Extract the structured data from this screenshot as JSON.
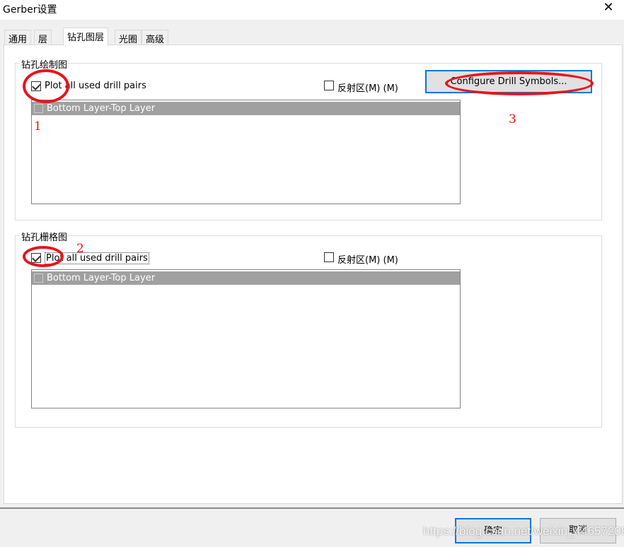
{
  "window": {
    "title": "Gerber设置",
    "close_icon": "close-icon"
  },
  "tabs": [
    {
      "label": "通用"
    },
    {
      "label": "层"
    },
    {
      "label": "钻孔图层",
      "active": true
    },
    {
      "label": "光圈"
    },
    {
      "label": "高级"
    }
  ],
  "drill_drawing": {
    "title": "钻孔绘制图",
    "plot_all": {
      "label": "Plot all used drill pairs",
      "checked": true
    },
    "mirror": {
      "label": "反射区(M) (M)",
      "checked": false
    },
    "configure_button": "Configure Drill Symbols...",
    "items": [
      {
        "label": "Bottom Layer-Top Layer",
        "checked": false
      }
    ]
  },
  "drill_grid": {
    "title": "钻孔栅格图",
    "plot_all": {
      "label": "Plot all used drill pairs",
      "checked": true
    },
    "mirror": {
      "label": "反射区(M) (M)",
      "checked": false
    },
    "items": [
      {
        "label": "Bottom Layer-Top Layer",
        "checked": false
      }
    ]
  },
  "annotations": [
    "1",
    "2",
    "3"
  ],
  "annotation_color": "#e8141c",
  "accent_color": "#0078d7",
  "footer": {
    "ok": "确定",
    "cancel": "取消"
  },
  "watermark": "https://blog.csdn.net/weixin_44657208"
}
